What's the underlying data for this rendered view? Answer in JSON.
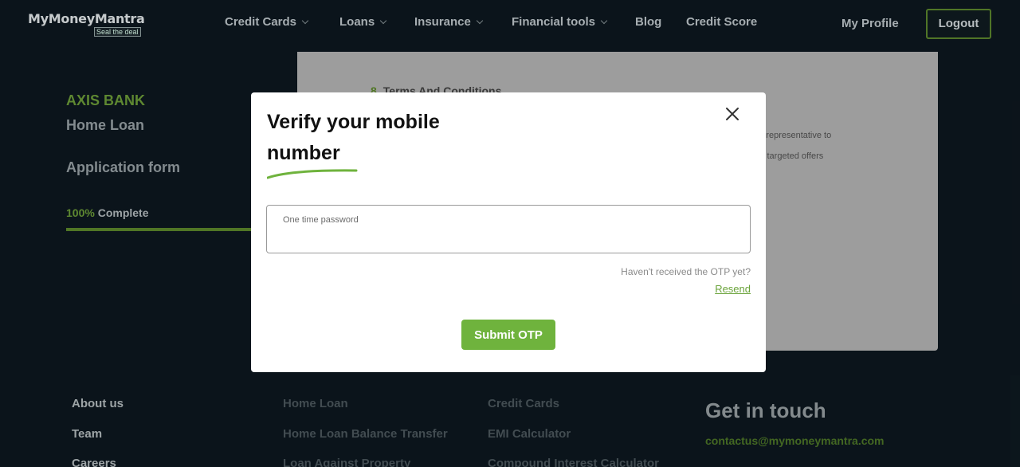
{
  "header": {
    "logo": {
      "name": "MyMoneyMantra",
      "tagline": "Seal the deal"
    },
    "nav": [
      {
        "label": "Credit Cards",
        "has_dropdown": true
      },
      {
        "label": "Loans",
        "has_dropdown": true
      },
      {
        "label": "Insurance",
        "has_dropdown": true
      },
      {
        "label": "Financial tools",
        "has_dropdown": true
      },
      {
        "label": "Blog",
        "has_dropdown": false
      },
      {
        "label": "Credit Score",
        "has_dropdown": false
      }
    ],
    "profile_label": "My Profile",
    "logout_label": "Logout"
  },
  "application": {
    "bank": "AXIS BANK",
    "loan_type": "Home Loan",
    "form_title": "Application form",
    "progress_percent": "100%",
    "progress_label": "Complete",
    "progress_value": 100
  },
  "card": {
    "heading_num": "8",
    "heading": "Terms And Conditions",
    "line1": "ed representative to",
    "line2": "t & targeted offers"
  },
  "modal": {
    "title": "Verify your mobile number",
    "otp_label": "One time password",
    "otp_value": "",
    "resend_question": "Haven't received the OTP yet?",
    "resend_label": "Resend",
    "submit_label": "Submit OTP"
  },
  "footer": {
    "col1": [
      "About us",
      "Team",
      "Careers"
    ],
    "col2": [
      "Home Loan",
      "Home Loan Balance Transfer",
      "Loan Against Property"
    ],
    "col3": [
      "Credit Cards",
      "EMI Calculator",
      "Compound Interest Calculator"
    ],
    "get_in_touch": "Get in touch",
    "email": "contactus@mymoneymantra.com"
  },
  "colors": {
    "accent_green": "#6fb33d",
    "dark_bg": "#0e1820"
  }
}
